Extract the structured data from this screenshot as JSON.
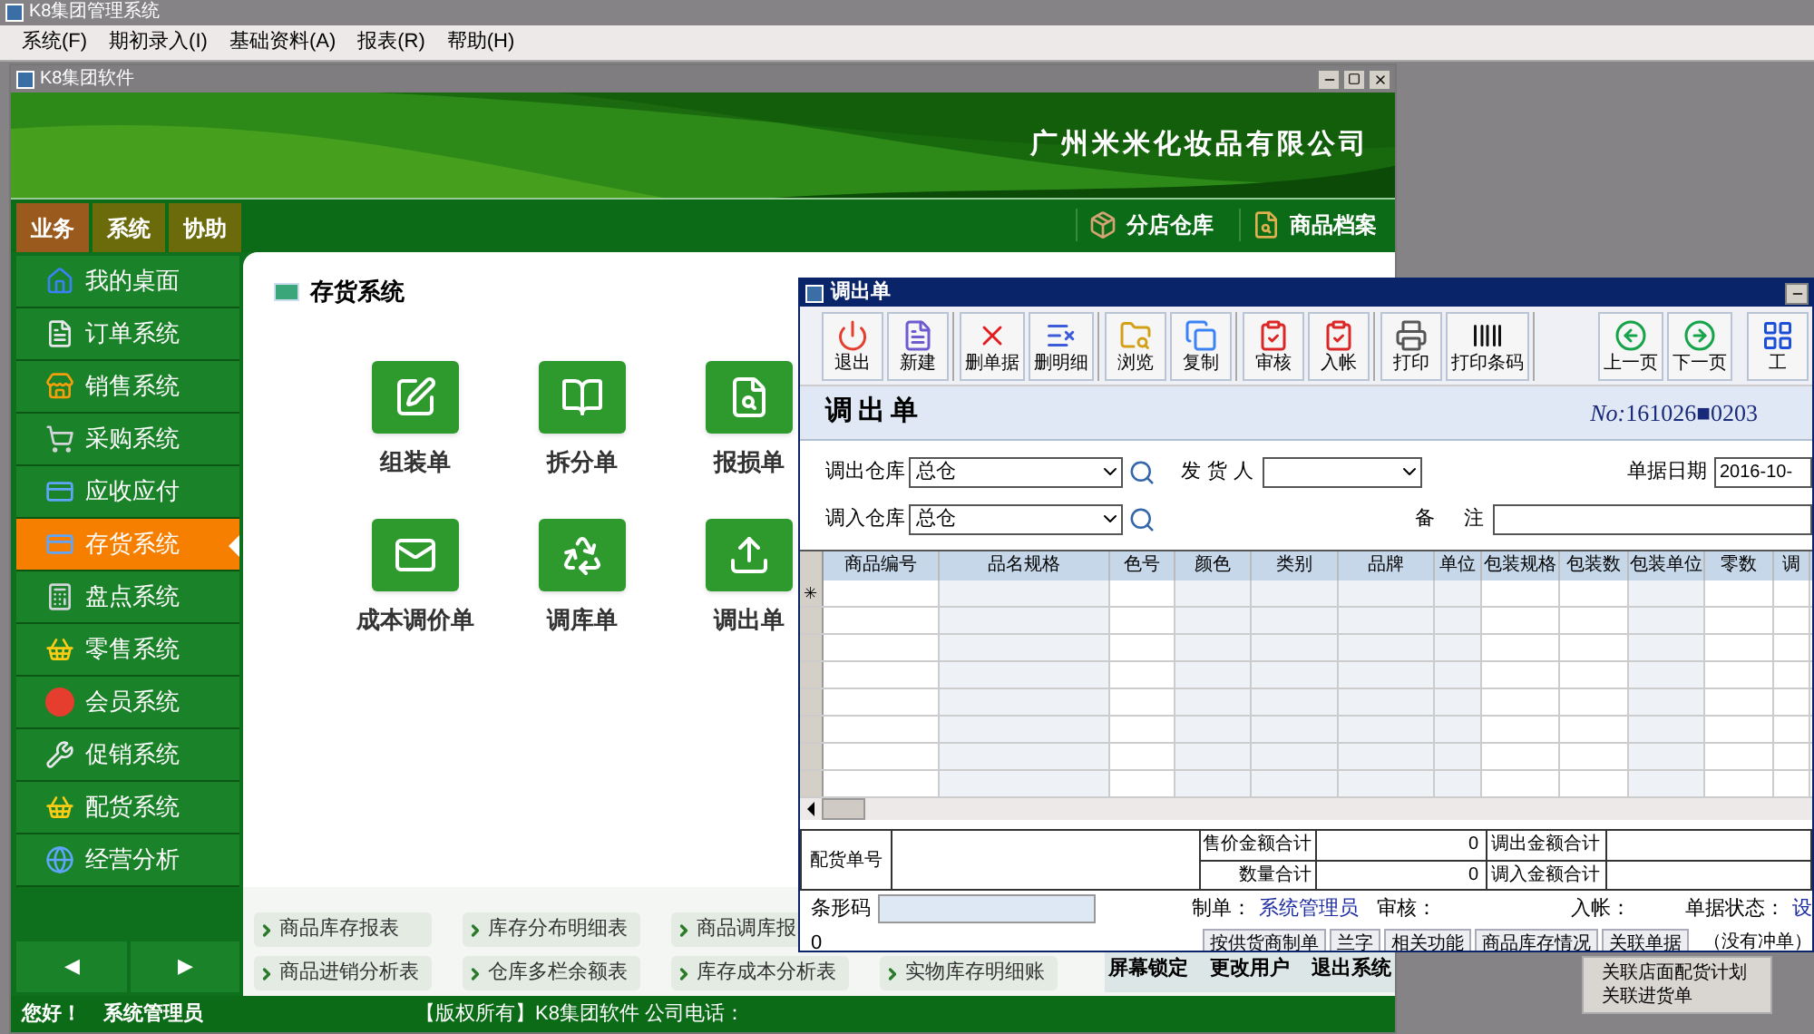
{
  "app": {
    "title": "K8集团管理系统",
    "menu": [
      "系统(F)",
      "期初录入(I)",
      "基础资料(A)",
      "报表(R)",
      "帮助(H)"
    ]
  },
  "main_window": {
    "title": "K8集团软件",
    "company": "广州米米化妆品有限公司",
    "nav_tabs": [
      {
        "label": "业务",
        "selected": true
      },
      {
        "label": "系统",
        "selected": false
      },
      {
        "label": "协助",
        "selected": false
      }
    ],
    "shortcuts": [
      {
        "label": "分店仓库",
        "kind": "box"
      },
      {
        "label": "商品档案",
        "kind": "file"
      }
    ],
    "sidebar": [
      {
        "label": "我的桌面",
        "kind": "home",
        "selected": false
      },
      {
        "label": "订单系统",
        "kind": "order",
        "selected": false
      },
      {
        "label": "销售系统",
        "kind": "store",
        "selected": false
      },
      {
        "label": "采购系统",
        "kind": "cart",
        "selected": false
      },
      {
        "label": "应收应付",
        "kind": "card",
        "selected": false
      },
      {
        "label": "存货系统",
        "kind": "card",
        "selected": true
      },
      {
        "label": "盘点系统",
        "kind": "calc",
        "selected": false
      },
      {
        "label": "零售系统",
        "kind": "basket",
        "selected": false
      },
      {
        "label": "会员系统",
        "kind": "vip",
        "selected": false
      },
      {
        "label": "促销系统",
        "kind": "tools",
        "selected": false
      },
      {
        "label": "配货系统",
        "kind": "basket",
        "selected": false
      },
      {
        "label": "经营分析",
        "kind": "globe",
        "selected": false
      }
    ],
    "pager": [
      "◀",
      "▶"
    ],
    "panel_title": "存货系统",
    "tiles": [
      {
        "label": "组装单",
        "kind": "pen"
      },
      {
        "label": "拆分单",
        "kind": "book"
      },
      {
        "label": "报损单",
        "kind": "search"
      },
      {
        "label": "成本调价单",
        "kind": "mail"
      },
      {
        "label": "调库单",
        "kind": "recycle"
      },
      {
        "label": "调出单",
        "kind": "upload"
      }
    ],
    "report_links": [
      [
        "商品库存报表",
        "库存分布明细表",
        "商品调库报"
      ],
      [
        "商品进销分析表",
        "仓库多栏余额表",
        "库存成本分析表",
        "实物库存明细账"
      ]
    ],
    "actions": [
      "屏幕锁定",
      "更改用户",
      "退出系统"
    ],
    "greeting": "您好！",
    "user": "系统管理员",
    "copyright": "【版权所有】K8集团软件 公司电话："
  },
  "dialog": {
    "title": "调出单",
    "toolbar": [
      [
        {
          "label": "退出",
          "kind": "power"
        },
        {
          "label": "新建",
          "kind": "doc"
        }
      ],
      [
        {
          "label": "删单据",
          "kind": "x"
        },
        {
          "label": "删明细",
          "kind": "list"
        }
      ],
      [
        {
          "label": "浏览",
          "kind": "folder"
        },
        {
          "label": "复制",
          "kind": "copy"
        }
      ],
      [
        {
          "label": "审核",
          "kind": "check"
        },
        {
          "label": "入帐",
          "kind": "check"
        }
      ],
      [
        {
          "label": "打印",
          "kind": "printer"
        },
        {
          "label": "打印条码",
          "kind": "barcode"
        }
      ],
      [
        {
          "label": "上一页",
          "kind": "left"
        },
        {
          "label": "下一页",
          "kind": "right"
        }
      ],
      [
        {
          "label": "工",
          "kind": "grid"
        }
      ]
    ],
    "heading": "调出单",
    "number_label": "No:",
    "number": "161026■0203",
    "out_warehouse": {
      "label": "调出仓库",
      "value": "总仓"
    },
    "shipper": {
      "label": "发 货 人"
    },
    "date": {
      "label": "单据日期",
      "value": "2016-10-"
    },
    "in_warehouse": {
      "label": "调入仓库",
      "value": "总仓"
    },
    "remark": {
      "label": "备 注"
    },
    "columns": [
      {
        "label": "商品编号",
        "shaded": false
      },
      {
        "label": "品名规格",
        "shaded": true
      },
      {
        "label": "色号",
        "shaded": false
      },
      {
        "label": "颜色",
        "shaded": true
      },
      {
        "label": "类别",
        "shaded": true
      },
      {
        "label": "品牌",
        "shaded": true
      },
      {
        "label": "单位",
        "shaded": true
      },
      {
        "label": "包装规格",
        "shaded": false
      },
      {
        "label": "包装数",
        "shaded": false
      },
      {
        "label": "包装单位",
        "shaded": true
      },
      {
        "label": "零数",
        "shaded": false
      },
      {
        "label": "调",
        "shaded": false
      }
    ],
    "new_row_marker": "✳",
    "order_no_label": "配货单号",
    "totals": [
      {
        "label": "售价金额合计",
        "value": "0",
        "other_label": "调出金额合计"
      },
      {
        "label": "数量合计",
        "value": "0",
        "other_label": "调入金额合计"
      }
    ],
    "barcode_label": "条形码",
    "count": "0",
    "maker_label": "制单：",
    "maker": "系统管理员",
    "auditor_label": "审核：",
    "posted_label": "入帐：",
    "status_label": "单据状态：",
    "status": "设",
    "buttons": [
      "按供货商制单",
      "兰字",
      "相关功能",
      "商品库存情况",
      "关联单据"
    ],
    "reversal": "（没有冲单）",
    "menu": [
      "关联店面配货计划",
      "关联进货单"
    ]
  }
}
